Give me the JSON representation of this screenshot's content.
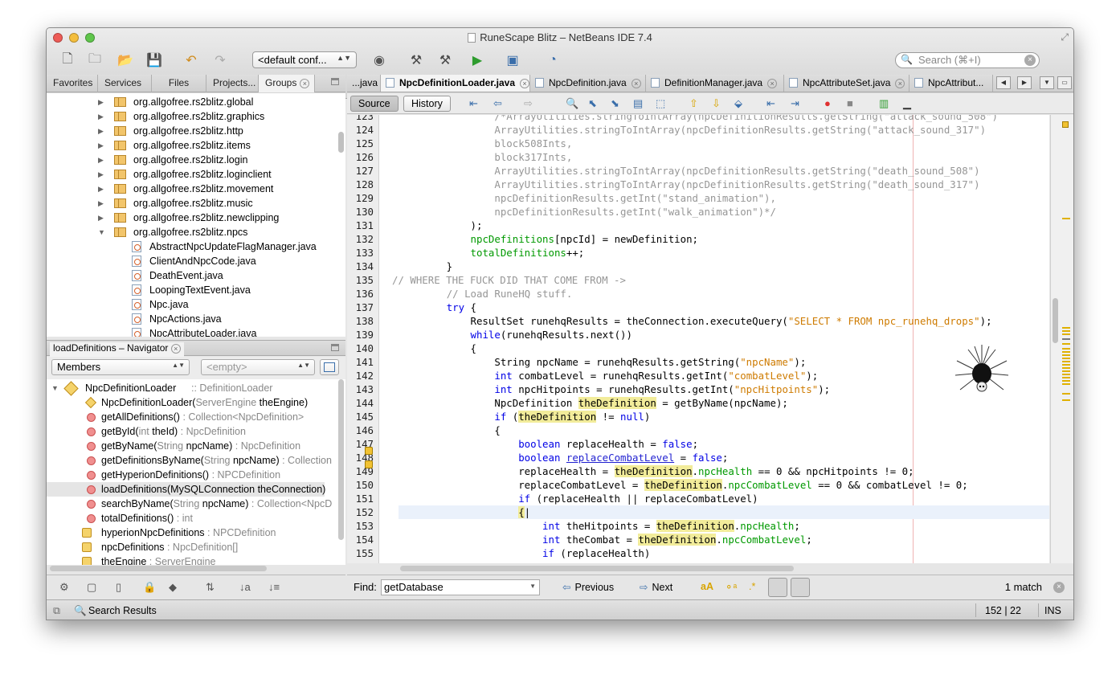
{
  "window": {
    "title": "RuneScape Blitz – NetBeans IDE 7.4"
  },
  "toolbar": {
    "config": "<default conf...",
    "search_placeholder": "Search (⌘+I)"
  },
  "left_tabs": [
    "Favorites",
    "Services",
    "Files",
    "Projects...",
    "Groups"
  ],
  "tree": {
    "packages": [
      "org.allgofree.rs2blitz.global",
      "org.allgofree.rs2blitz.graphics",
      "org.allgofree.rs2blitz.http",
      "org.allgofree.rs2blitz.items",
      "org.allgofree.rs2blitz.login",
      "org.allgofree.rs2blitz.loginclient",
      "org.allgofree.rs2blitz.movement",
      "org.allgofree.rs2blitz.music",
      "org.allgofree.rs2blitz.newclipping",
      "org.allgofree.rs2blitz.npcs"
    ],
    "files": [
      "AbstractNpcUpdateFlagManager.java",
      "ClientAndNpcCode.java",
      "DeathEvent.java",
      "LoopingTextEvent.java",
      "Npc.java",
      "NpcActions.java",
      "NpcAttributeLoader.java"
    ]
  },
  "navigator": {
    "title": "loadDefinitions – Navigator",
    "filter": "Members",
    "empty": "<empty>",
    "class_name": "NpcDefinitionLoader",
    "class_super": " :: DefinitionLoader",
    "members": [
      {
        "kind": "ctor",
        "name": "NpcDefinitionLoader(",
        "params_type": "ServerEngine",
        "params_name": " theEngine)",
        "ret": ""
      },
      {
        "kind": "method",
        "name": "getAllDefinitions()",
        "params_type": "",
        "params_name": "",
        "ret": " : Collection<NpcDefinition>"
      },
      {
        "kind": "method",
        "name": "getById(",
        "params_type": "int",
        "params_name": " theId)",
        "ret": " : NpcDefinition"
      },
      {
        "kind": "method",
        "name": "getByName(",
        "params_type": "String",
        "params_name": " npcName)",
        "ret": " : NpcDefinition"
      },
      {
        "kind": "method",
        "name": "getDefinitionsByName(",
        "params_type": "String",
        "params_name": " npcName)",
        "ret": " : Collection"
      },
      {
        "kind": "method",
        "name": "getHyperionDefinitions()",
        "params_type": "",
        "params_name": "",
        "ret": " : NPCDefinition"
      },
      {
        "kind": "method",
        "name": "loadDefinitions(",
        "params_type": "MySQLConnection",
        "params_name": " theConnection)",
        "ret": ""
      },
      {
        "kind": "method",
        "name": "searchByName(",
        "params_type": "String",
        "params_name": " npcName)",
        "ret": " : Collection<NpcD"
      },
      {
        "kind": "method",
        "name": "totalDefinitions()",
        "params_type": "",
        "params_name": "",
        "ret": " : int"
      },
      {
        "kind": "field",
        "name": "hyperionNpcDefinitions",
        "params_type": "",
        "params_name": "",
        "ret": " : NPCDefinition"
      },
      {
        "kind": "field",
        "name": "npcDefinitions",
        "params_type": "",
        "params_name": "",
        "ret": " : NpcDefinition[]"
      },
      {
        "kind": "field",
        "name": "theEngine",
        "params_type": "",
        "params_name": "",
        "ret": " : ServerEngine"
      }
    ]
  },
  "editor": {
    "tabs": [
      "...java",
      "NpcDefinitionLoader.java",
      "NpcDefinition.java",
      "DefinitionManager.java",
      "NpcAttributeSet.java",
      "NpcAttribut..."
    ],
    "source_label": "Source",
    "history_label": "History",
    "line_numbers": [
      "123",
      "124",
      "125",
      "126",
      "127",
      "128",
      "129",
      "130",
      "131",
      "132",
      "133",
      "134",
      "135",
      "136",
      "137",
      "138",
      "139",
      "140",
      "141",
      "142",
      "143",
      "144",
      "145",
      "146",
      "147",
      "148",
      "149",
      "150",
      "151",
      "152",
      "153",
      "154",
      "155"
    ]
  },
  "findbar": {
    "label": "Find:",
    "value": "getDatabase",
    "previous": "Previous",
    "next": "Next",
    "match": "1 match"
  },
  "status": {
    "search_results": "Search Results",
    "position": "152 | 22",
    "mode": "INS"
  }
}
